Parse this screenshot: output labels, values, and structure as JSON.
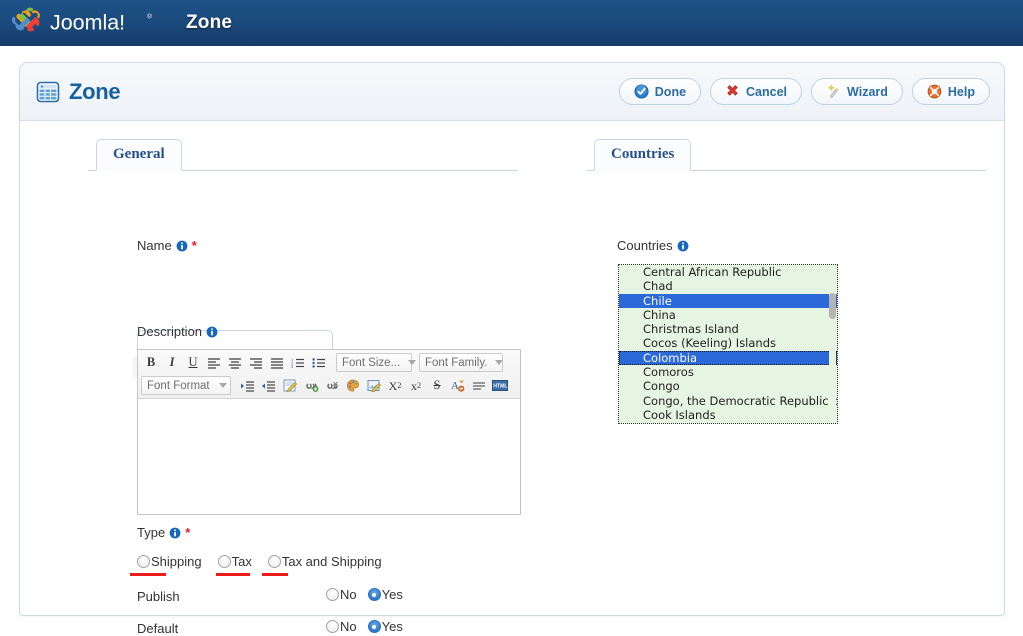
{
  "topbar": {
    "brand": "Joomla!",
    "app_title": "Zone",
    "logo_icon": "joomla-logo-icon"
  },
  "page": {
    "title": "Zone",
    "title_icon": "grid-table-icon"
  },
  "toolbar": {
    "buttons": [
      {
        "label": "Done",
        "icon": "check-circle-icon"
      },
      {
        "label": "Cancel",
        "icon": "red-x-icon"
      },
      {
        "label": "Wizard",
        "icon": "magic-wand-icon"
      },
      {
        "label": "Help",
        "icon": "life-ring-icon"
      }
    ]
  },
  "general": {
    "tab_label": "General",
    "name": {
      "label": "Name",
      "value": "",
      "placeholder": "",
      "required_marker": "*",
      "info_icon": "info-icon"
    },
    "description": {
      "label": "Description",
      "info_icon": "info-icon",
      "content": ""
    },
    "editor": {
      "row1": [
        {
          "name": "bold-icon",
          "glyph": "B"
        },
        {
          "name": "italic-icon",
          "glyph": "I"
        },
        {
          "name": "underline-icon",
          "glyph": "U"
        },
        {
          "name": "align-left-icon",
          "glyph": ""
        },
        {
          "name": "align-center-icon",
          "glyph": ""
        },
        {
          "name": "align-right-icon",
          "glyph": ""
        },
        {
          "name": "align-justify-icon",
          "glyph": ""
        },
        {
          "name": "ordered-list-icon",
          "glyph": ""
        },
        {
          "name": "unordered-list-icon",
          "glyph": ""
        }
      ],
      "font_size_label": "Font Size...",
      "font_family_label": "Font Family.",
      "font_format_label": "Font Format",
      "row2": [
        {
          "name": "indent-icon"
        },
        {
          "name": "outdent-icon"
        },
        {
          "name": "edit-icon"
        },
        {
          "name": "insert-link-icon"
        },
        {
          "name": "unlink-icon"
        },
        {
          "name": "color-palette-icon"
        },
        {
          "name": "edit-image-icon"
        },
        {
          "name": "subscript-icon",
          "glyph": "X₂"
        },
        {
          "name": "superscript-icon",
          "glyph": "x²"
        },
        {
          "name": "strikethrough-icon",
          "glyph": "S"
        },
        {
          "name": "remove-format-icon"
        },
        {
          "name": "horizontal-rule-icon"
        },
        {
          "name": "html-source-icon",
          "glyph": "HTML"
        }
      ]
    },
    "type": {
      "label": "Type",
      "required_marker": "*",
      "info_icon": "info-icon",
      "options": [
        {
          "label": "Shipping",
          "selected": false
        },
        {
          "label": "Tax",
          "selected": false
        },
        {
          "label": "Tax and Shipping",
          "selected": false
        }
      ]
    },
    "publish": {
      "label": "Publish",
      "options": [
        {
          "label": "No",
          "selected": false
        },
        {
          "label": "Yes",
          "selected": true
        }
      ]
    },
    "default": {
      "label": "Default",
      "options": [
        {
          "label": "No",
          "selected": false
        },
        {
          "label": "Yes",
          "selected": true
        }
      ]
    }
  },
  "countries": {
    "tab_label": "Countries",
    "field_label": "Countries",
    "info_icon": "info-icon",
    "items": [
      {
        "label": "Central African Republic",
        "selected": false
      },
      {
        "label": "Chad",
        "selected": false
      },
      {
        "label": "Chile",
        "selected": true
      },
      {
        "label": "China",
        "selected": false
      },
      {
        "label": "Christmas Island",
        "selected": false
      },
      {
        "label": "Cocos (Keeling) Islands",
        "selected": false
      },
      {
        "label": "Colombia",
        "selected": true,
        "focused": true
      },
      {
        "label": "Comoros",
        "selected": false
      },
      {
        "label": "Congo",
        "selected": false
      },
      {
        "label": "Congo, the Democratic Republic of",
        "selected": false
      },
      {
        "label": "Cook Islands",
        "selected": false
      }
    ]
  },
  "colors": {
    "topbar_blue": "#1b4a7c",
    "accent_blue": "#16609e",
    "selection_blue": "#2b68d8",
    "list_background": "#e6f5e1",
    "required_red": "#e8192c",
    "marker_red": "#ee1b1b"
  }
}
